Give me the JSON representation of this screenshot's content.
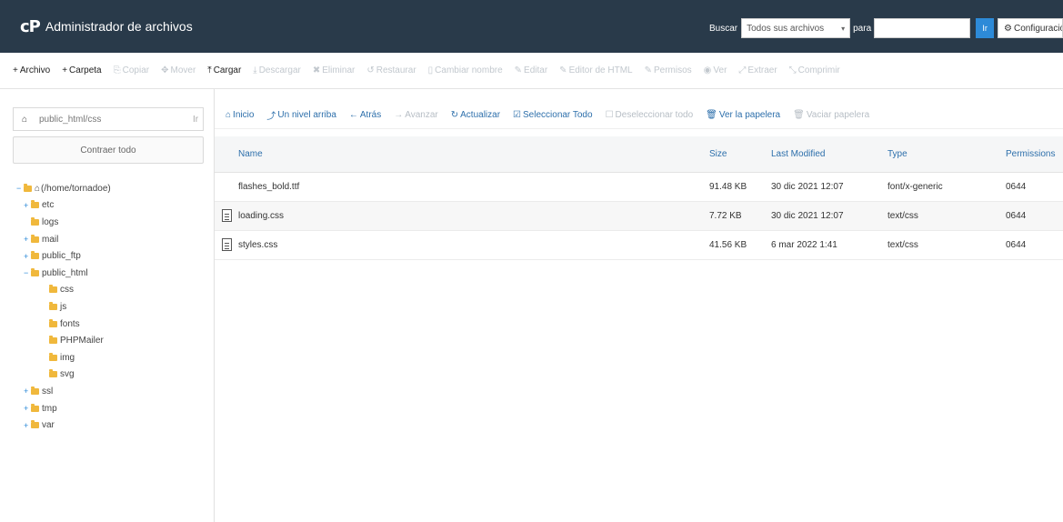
{
  "header": {
    "app_title": "Administrador de archivos",
    "search_label": "Buscar",
    "search_scope": "Todos sus archivos",
    "for_label": "para",
    "search_value": "",
    "go_label": "Ir",
    "settings_label": "Configuración"
  },
  "toolbar": {
    "items": [
      {
        "label": "Archivo",
        "prefix": "+"
      },
      {
        "label": "Carpeta",
        "prefix": "+"
      },
      {
        "label": "Copiar",
        "prefix": "⎘"
      },
      {
        "label": "Mover",
        "prefix": "✥"
      },
      {
        "label": "Cargar",
        "prefix": "⤒"
      },
      {
        "label": "Descargar",
        "prefix": "⤓"
      },
      {
        "label": "Eliminar",
        "prefix": "✖"
      },
      {
        "label": "Restaurar",
        "prefix": "↺"
      },
      {
        "label": "Cambiar nombre",
        "prefix": "▯"
      },
      {
        "label": "Editar",
        "prefix": "✎"
      },
      {
        "label": "Editor de HTML",
        "prefix": "✎"
      },
      {
        "label": "Permisos",
        "prefix": "✎"
      },
      {
        "label": "Ver",
        "prefix": "◉"
      },
      {
        "label": "Extraer",
        "prefix": "⤢"
      },
      {
        "label": "Comprimir",
        "prefix": "⤡"
      }
    ]
  },
  "sidebar": {
    "path_value": "public_html/css",
    "path_go": "Ir",
    "collapse_label": "Contraer todo",
    "tree": [
      {
        "label": "(/home/tornadoe)",
        "level": 0,
        "expander": "−"
      },
      {
        "label": "etc",
        "level": 1,
        "expander": "+"
      },
      {
        "label": "logs",
        "level": 1,
        "expander": ""
      },
      {
        "label": "mail",
        "level": 1,
        "expander": "+"
      },
      {
        "label": "public_ftp",
        "level": 1,
        "expander": "+"
      },
      {
        "label": "public_html",
        "level": 1,
        "expander": "−"
      },
      {
        "label": "css",
        "level": 2,
        "expander": ""
      },
      {
        "label": "js",
        "level": 2,
        "expander": ""
      },
      {
        "label": "fonts",
        "level": 2,
        "expander": ""
      },
      {
        "label": "PHPMailer",
        "level": 2,
        "expander": ""
      },
      {
        "label": "img",
        "level": 2,
        "expander": ""
      },
      {
        "label": "svg",
        "level": 2,
        "expander": ""
      },
      {
        "label": "ssl",
        "level": 1,
        "expander": "+"
      },
      {
        "label": "tmp",
        "level": 1,
        "expander": "+"
      },
      {
        "label": "var",
        "level": 1,
        "expander": "+"
      }
    ]
  },
  "actionbar": {
    "items": [
      {
        "label": "Inicio",
        "icon": "⌂"
      },
      {
        "label": "Un nivel arriba",
        "icon": "⤴"
      },
      {
        "label": "Atrás",
        "icon": "←"
      },
      {
        "label": "Avanzar",
        "icon": "→"
      },
      {
        "label": "Actualizar",
        "icon": "↻"
      },
      {
        "label": "Seleccionar Todo",
        "icon": "☑"
      },
      {
        "label": "Deseleccionar todo",
        "icon": "☐"
      },
      {
        "label": "Ver la papelera",
        "icon": "🗑"
      },
      {
        "label": "Vaciar papelera",
        "icon": "🗑"
      }
    ]
  },
  "table": {
    "columns": [
      "Name",
      "Size",
      "Last Modified",
      "Type",
      "Permissions"
    ],
    "rows": [
      {
        "name": "flashes_bold.ttf",
        "size": "91.48 KB",
        "modified": "30 dic 2021 12:07",
        "type": "font/x-generic",
        "perms": "0644"
      },
      {
        "name": "loading.css",
        "size": "7.72 KB",
        "modified": "30 dic 2021 12:07",
        "type": "text/css",
        "perms": "0644"
      },
      {
        "name": "styles.css",
        "size": "41.56 KB",
        "modified": "6 mar 2022 1:41",
        "type": "text/css",
        "perms": "0644"
      }
    ]
  },
  "colors": {
    "header_bg": "#293a4a",
    "accent": "#2d8ad8",
    "link": "#2d6fab",
    "folder": "#f0b83c"
  }
}
